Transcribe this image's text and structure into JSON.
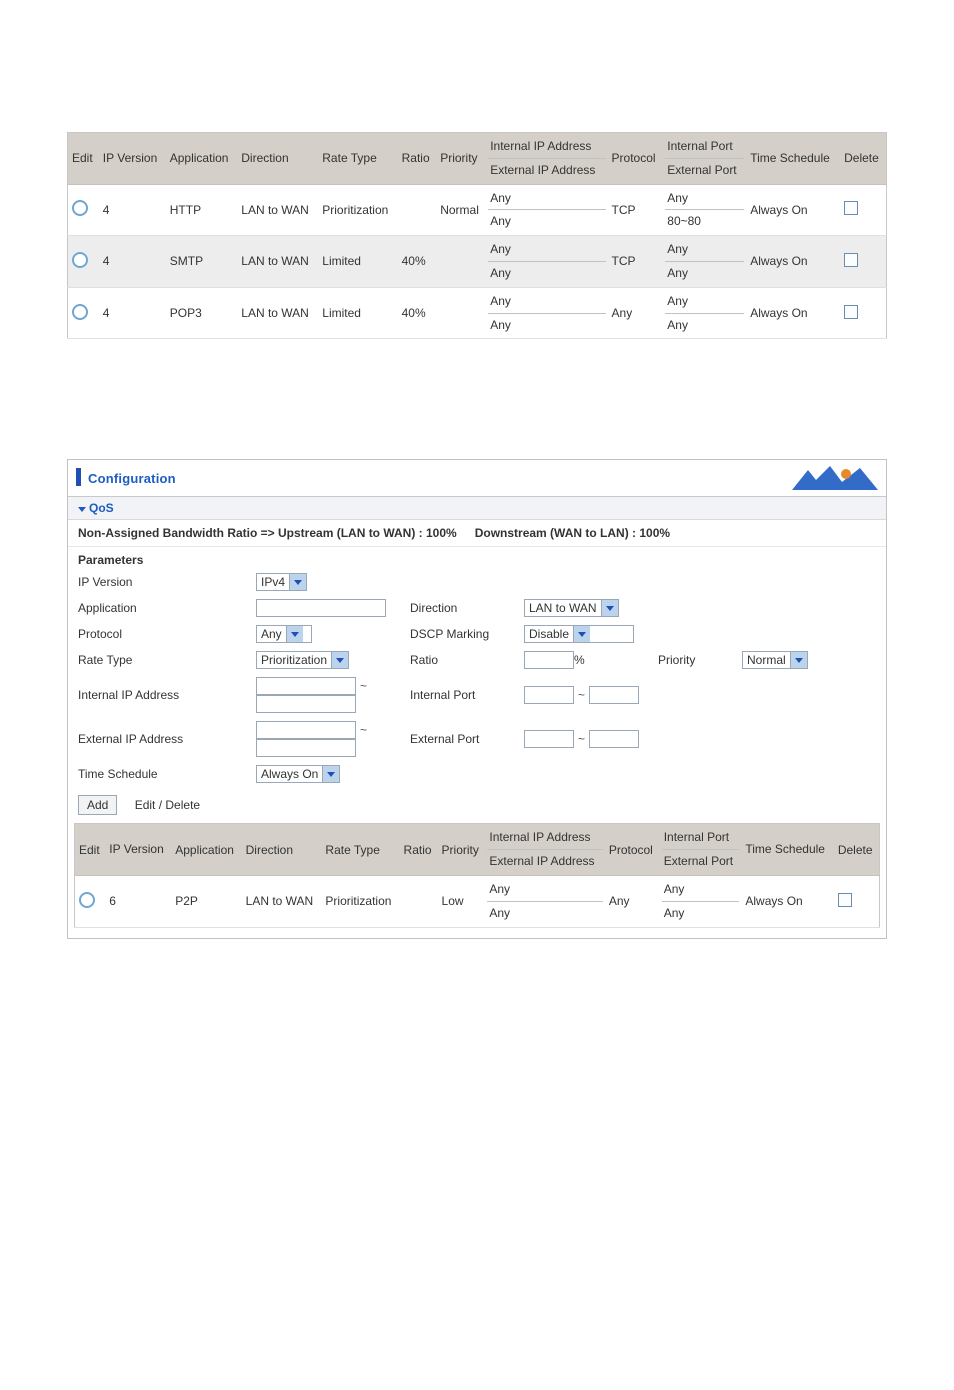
{
  "tables": {
    "headers": {
      "edit": "Edit",
      "ipver": "IP\nVersion",
      "app": "Application",
      "dir": "Direction",
      "rate": "Rate Type",
      "ratio": "Ratio",
      "prio": "Priority",
      "iip": "Internal IP Address",
      "eip": "External IP Address",
      "proto": "Protocol",
      "iport": "Internal Port",
      "eport": "External Port",
      "ts": "Time\nSchedule",
      "del": "Delete"
    },
    "top_rows": [
      {
        "ipver": "4",
        "app": "HTTP",
        "dir": "LAN to WAN",
        "rate": "Prioritization",
        "ratio": "",
        "prio": "Normal",
        "iip": "Any",
        "eip": "Any",
        "proto": "TCP",
        "iport": "Any",
        "eport": "80~80",
        "ts": "Always On"
      },
      {
        "ipver": "4",
        "app": "SMTP",
        "dir": "LAN to WAN",
        "rate": "Limited",
        "ratio": "40%",
        "prio": "",
        "iip": "Any",
        "eip": "Any",
        "proto": "TCP",
        "iport": "Any",
        "eport": "Any",
        "ts": "Always On"
      },
      {
        "ipver": "4",
        "app": "POP3",
        "dir": "LAN to WAN",
        "rate": "Limited",
        "ratio": "40%",
        "prio": "",
        "iip": "Any",
        "eip": "Any",
        "proto": "Any",
        "iport": "Any",
        "eport": "Any",
        "ts": "Always On"
      }
    ],
    "bottom_rows": [
      {
        "ipver": "6",
        "app": "P2P",
        "dir": "LAN to WAN",
        "rate": "Prioritization",
        "ratio": "",
        "prio": "Low",
        "iip": "Any",
        "eip": "Any",
        "proto": "Any",
        "iport": "Any",
        "eport": "Any",
        "ts": "Always On"
      }
    ]
  },
  "panel": {
    "title": "Configuration",
    "section": "QoS",
    "ratio_line_a": "Non-Assigned Bandwidth Ratio => Upstream (LAN to WAN) : 100%",
    "ratio_line_b": "Downstream (WAN to LAN) : 100%",
    "params": "Parameters",
    "labels": {
      "ipver": "IP Version",
      "app": "Application",
      "dir": "Direction",
      "proto": "Protocol",
      "dscp": "DSCP Marking",
      "rate": "Rate Type",
      "ratio": "Ratio",
      "pct": "%",
      "prio": "Priority",
      "iip": "Internal IP Address",
      "iport": "Internal Port",
      "eip": "External IP Address",
      "eport": "External Port",
      "ts": "Time Schedule"
    },
    "selects": {
      "ipver": "IPv4",
      "dir": "LAN to WAN",
      "proto": "Any",
      "dscp": "Disable",
      "rate": "Prioritization",
      "prio": "Normal",
      "ts": "Always On"
    },
    "add_btn": "Add",
    "edit_delete": "Edit / Delete"
  }
}
